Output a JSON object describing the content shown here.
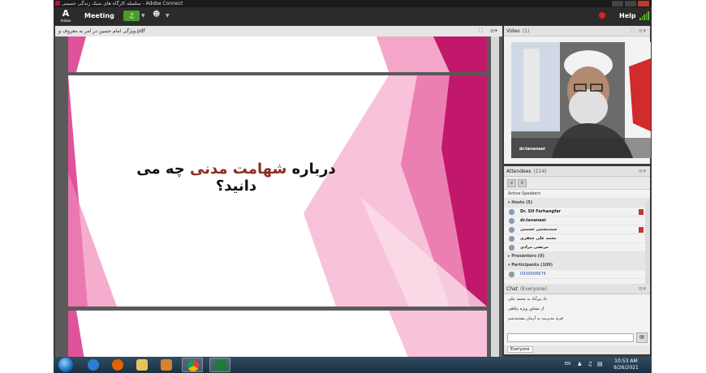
{
  "window": {
    "title": "سلسله کارگاه های سبک زندگی حسینی - Adobe Connect"
  },
  "menubar": {
    "logo_text": "A",
    "logo_subtext": "Adobe",
    "meeting_label": "Meeting",
    "help_label": "Help"
  },
  "share_pod": {
    "filename": "ویژگی امام حسین در امر به معروف و.pdf"
  },
  "slide": {
    "question_part1": "درباره ",
    "question_highlight": "شهامت مدنی",
    "question_part2": " چه می دانید؟",
    "accent_colors": [
      "#e0539a",
      "#c2186b",
      "#f4a6c9"
    ]
  },
  "video_pod": {
    "title": "Video",
    "count": "(1)",
    "presenter_name": "dr.tavanaei"
  },
  "attendees_pod": {
    "title": "Attendees",
    "count": "(114)",
    "active_speakers_label": "Active Speakers",
    "hosts_label": "Hosts (5)",
    "hosts": [
      {
        "name": "Dr. SH Farhangfar",
        "mic": true
      },
      {
        "name": "dr.tavanaei",
        "mic": false
      },
      {
        "name": "سیدمجتبی حسینی",
        "mic": true
      },
      {
        "name": "محمد علی چغفری",
        "mic": false
      },
      {
        "name": "مرتضی مرادی",
        "mic": false
      }
    ],
    "presenters_label": "Presenters (0)",
    "participants_label": "Participants (109)",
    "participants": [
      "0939566676"
    ]
  },
  "chat_pod": {
    "title": "Chat",
    "scope": "(Everyone)",
    "messages": [
      "یاد پیرآباد به محمد علی",
      "از مشاور ویژه رفاهی",
      "فربه مدیریت به آرمان مقدمه‌سم"
    ],
    "recipient_label": "Everyone"
  },
  "taskbar": {
    "language": "EN",
    "time": "10:53 AM",
    "date": "9/26/2021"
  }
}
